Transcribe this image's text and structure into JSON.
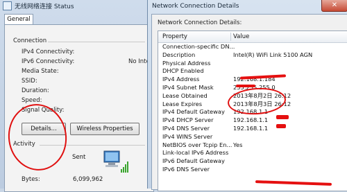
{
  "status_window": {
    "title": "无线网络连接 Status",
    "tab": "General",
    "connection_label": "Connection",
    "rows": [
      {
        "label": "IPv4 Connectivity:",
        "value": ""
      },
      {
        "label": "IPv6 Connectivity:",
        "value": "No Inte"
      },
      {
        "label": "Media State:",
        "value": ""
      },
      {
        "label": "SSID:",
        "value": ""
      },
      {
        "label": "Duration:",
        "value": ""
      },
      {
        "label": "Speed:",
        "value": ""
      },
      {
        "label": "Signal Quality:",
        "value": ""
      }
    ],
    "details_button": "Details...",
    "wireless_button": "Wireless Properties",
    "activity_label": "Activity",
    "sent_label": "Sent",
    "bytes_label": "Bytes:",
    "bytes_value": "6,099,962"
  },
  "details_window": {
    "title": "Network Connection Details",
    "close_glyph": "✕",
    "section_label": "Network Connection Details:",
    "header_property": "Property",
    "header_value": "Value",
    "rows": [
      {
        "property": "Connection-specific DN...",
        "value": ""
      },
      {
        "property": "Description",
        "value": "Intel(R) WiFi Link 5100 AGN"
      },
      {
        "property": "Physical Address",
        "value": ""
      },
      {
        "property": "DHCP Enabled",
        "value": ""
      },
      {
        "property": "IPv4 Address",
        "value": "192.168.1.184"
      },
      {
        "property": "IPv4 Subnet Mask",
        "value": "255.255.255.0"
      },
      {
        "property": "Lease Obtained",
        "value": "2013年8月2日 26:12"
      },
      {
        "property": "Lease Expires",
        "value": "2013年8月3日 26:12"
      },
      {
        "property": "IPv4 Default Gateway",
        "value": "192.168.1.1"
      },
      {
        "property": "IPv4 DHCP Server",
        "value": "192.168.1.1"
      },
      {
        "property": "IPv4 DNS Server",
        "value": "192.168.1.1"
      },
      {
        "property": "IPv4 WINS Server",
        "value": ""
      },
      {
        "property": "NetBIOS over Tcpip En...",
        "value": "Yes"
      },
      {
        "property": "Link-local IPv6 Address",
        "value": ""
      },
      {
        "property": "IPv6 Default Gateway",
        "value": ""
      },
      {
        "property": "IPv6 DNS Server",
        "value": ""
      }
    ]
  },
  "colors": {
    "annotation_red": "#e01010"
  }
}
